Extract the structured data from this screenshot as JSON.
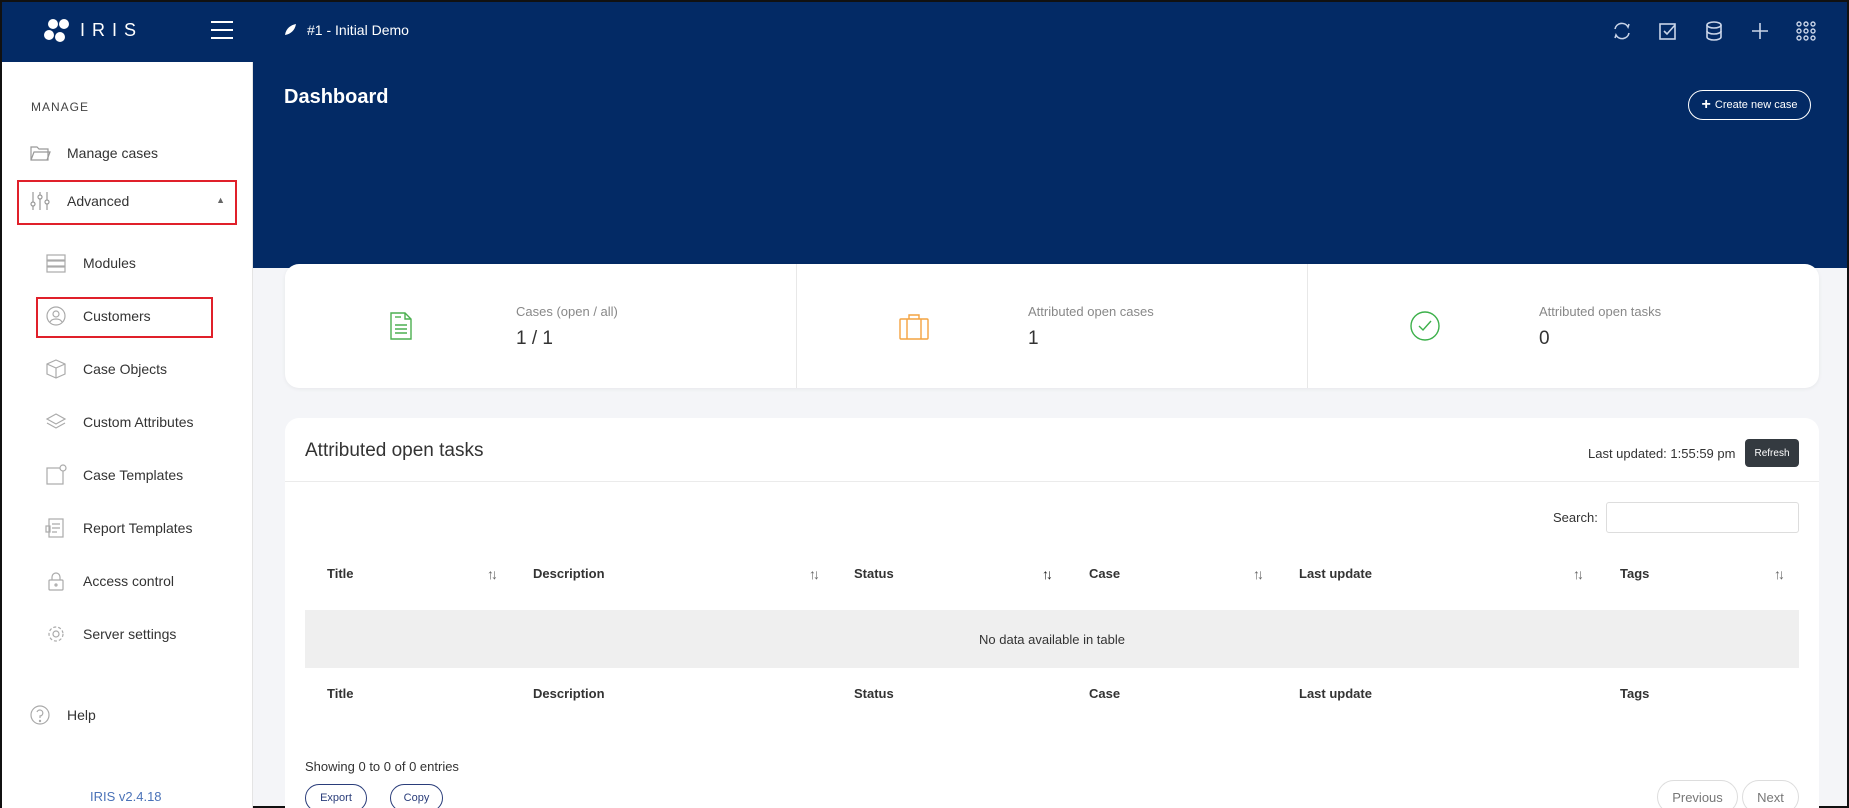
{
  "app": {
    "logo_text": "IRIS"
  },
  "header": {
    "case_title": "#1 - Initial Demo"
  },
  "sidebar": {
    "section_heading": "MANAGE",
    "items": [
      {
        "label": "Manage cases"
      },
      {
        "label": "Advanced"
      },
      {
        "label": "Modules"
      },
      {
        "label": "Customers"
      },
      {
        "label": "Case Objects"
      },
      {
        "label": "Custom Attributes"
      },
      {
        "label": "Case Templates"
      },
      {
        "label": "Report Templates"
      },
      {
        "label": "Access control"
      },
      {
        "label": "Server settings"
      },
      {
        "label": "Help"
      }
    ],
    "version": "IRIS v2.4.18"
  },
  "page": {
    "title": "Dashboard",
    "create_button": "Create new case"
  },
  "stats": [
    {
      "label": "Cases (open / all)",
      "value": "1 / 1",
      "icon": "document-icon",
      "color": "#4caf50"
    },
    {
      "label": "Attributed open cases",
      "value": "1",
      "icon": "briefcase-icon",
      "color": "#f4a340"
    },
    {
      "label": "Attributed open tasks",
      "value": "0",
      "icon": "check-circle-icon",
      "color": "#3cb04a"
    }
  ],
  "tasks": {
    "title": "Attributed open tasks",
    "last_updated": "Last updated: 1:55:59 pm",
    "refresh": "Refresh",
    "search_label": "Search:",
    "search_value": "",
    "columns": [
      "Title",
      "Description",
      "Status",
      "Case",
      "Last update",
      "Tags"
    ],
    "empty_message": "No data available in table",
    "showing": "Showing 0 to 0 of 0 entries",
    "export": "Export",
    "copy": "Copy",
    "previous": "Previous",
    "next": "Next"
  },
  "colors": {
    "navy": "#032a65",
    "highlight": "#e0202a"
  }
}
